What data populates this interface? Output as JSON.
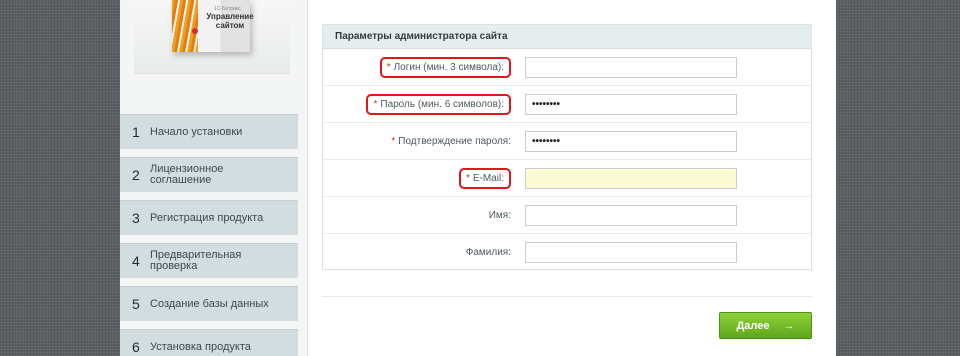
{
  "product": {
    "box_subtitle": "1С-Битрикс",
    "box_title": "Управление сайтом"
  },
  "steps": [
    {
      "num": "1",
      "label": "Начало установки"
    },
    {
      "num": "2",
      "label": "Лицензионное соглашение"
    },
    {
      "num": "3",
      "label": "Регистрация продукта"
    },
    {
      "num": "4",
      "label": "Предварительная проверка"
    },
    {
      "num": "5",
      "label": "Создание базы данных"
    },
    {
      "num": "6",
      "label": "Установка продукта"
    }
  ],
  "form": {
    "title": "Параметры администратора сайта",
    "fields": [
      {
        "required": "*",
        "label": "Логин (мин. 3 символа):",
        "value": ""
      },
      {
        "required": "*",
        "label": "Пароль (мин. 6 символов):",
        "value": "••••••••"
      },
      {
        "required": "*",
        "label": "Подтверждение пароля:",
        "value": "••••••••"
      },
      {
        "required": "*",
        "label": "E-Mail:",
        "value": ""
      },
      {
        "required": "",
        "label": "Имя:",
        "value": ""
      },
      {
        "required": "",
        "label": "Фамилия:",
        "value": ""
      }
    ]
  },
  "next_button": {
    "label": "Далее",
    "arrow": "→"
  },
  "colors": {
    "required_marker": "#d0302a",
    "highlight_border": "#e3141c",
    "button_green": "#6cb523",
    "email_field_bg": "#fbfcd4"
  }
}
